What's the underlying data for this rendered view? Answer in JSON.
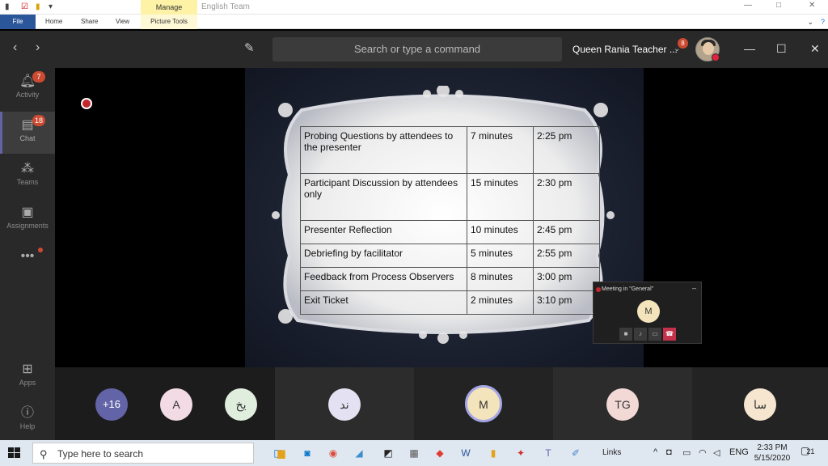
{
  "office": {
    "manage_tab": "Manage",
    "document_title": "English Team",
    "tabs": [
      "File",
      "Home",
      "Share",
      "View"
    ],
    "picture_tools": "Picture Tools"
  },
  "teams": {
    "search_placeholder": "Search or type a command",
    "org_name": "Queen Rania Teacher ...",
    "org_badge": "8",
    "rail": [
      {
        "label": "Activity",
        "badge": "7",
        "icon": "bell-icon"
      },
      {
        "label": "Chat",
        "badge": "18",
        "icon": "chat-icon"
      },
      {
        "label": "Teams",
        "icon": "teams-icon"
      },
      {
        "label": "Assignments",
        "icon": "assignments-icon"
      },
      {
        "label": "Apps",
        "icon": "apps-icon"
      },
      {
        "label": "Help",
        "icon": "help-icon"
      }
    ]
  },
  "slide": {
    "rows": [
      {
        "activity": "Probing Questions by attendees to the presenter",
        "duration": "7 minutes",
        "time": "2:25 pm"
      },
      {
        "activity": "Participant Discussion by attendees only",
        "duration": "15 minutes",
        "time": "2:30 pm"
      },
      {
        "activity": "Presenter Reflection",
        "duration": "10 minutes",
        "time": "2:45 pm"
      },
      {
        "activity": "Debriefing by facilitator",
        "duration": "5 minutes",
        "time": "2:55 pm"
      },
      {
        "activity": "Feedback from Process Observers",
        "duration": "8 minutes",
        "time": "3:00 pm"
      },
      {
        "activity": "Exit Ticket",
        "duration": "2  minutes",
        "time": "3:10 pm"
      }
    ]
  },
  "mini_window": {
    "title": "Meeting in \"General\"",
    "avatar": "M"
  },
  "participants": {
    "more": "+16",
    "people": [
      "A",
      "يخ",
      "ند",
      "M",
      "TG",
      "سا"
    ]
  },
  "taskbar": {
    "search_placeholder": "Type here to search",
    "links": "Links",
    "lang": "ENG",
    "time": "2:33 PM",
    "date": "5/15/2020",
    "notifications": "21"
  }
}
